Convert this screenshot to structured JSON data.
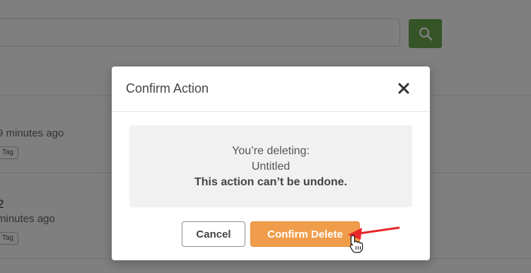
{
  "background": {
    "search": {
      "placeholder": ""
    },
    "items": [
      {
        "title": "",
        "meta": "9 minutes ago",
        "tag": "Tag"
      },
      {
        "title": "2",
        "meta": "minutes ago",
        "tag": "Tag"
      }
    ]
  },
  "modal": {
    "title": "Confirm Action",
    "message": {
      "line1": "You’re deleting:",
      "line2": "Untitled",
      "line3": "This action can’t be undone."
    },
    "cancel_label": "Cancel",
    "confirm_label": "Confirm Delete"
  },
  "colors": {
    "search_button": "#6aa84f",
    "confirm_button": "#f09d4b",
    "annotation_arrow": "#e8282b"
  },
  "icons": {
    "search": "search-icon",
    "close": "close-icon",
    "cursor": "hand-pointer-icon",
    "annotation": "red-arrow-icon"
  }
}
